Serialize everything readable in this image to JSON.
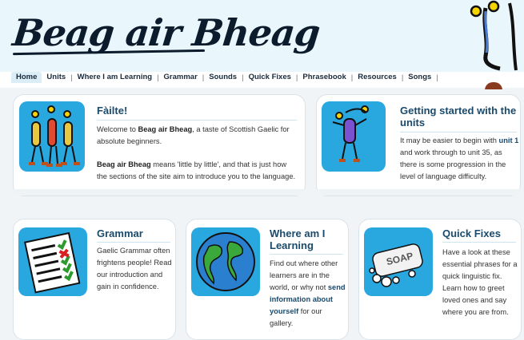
{
  "site": {
    "logo_text": "Beag air Bheag"
  },
  "nav": {
    "items": [
      "Home",
      "Units",
      "Where I am Learning",
      "Grammar",
      "Sounds",
      "Quick Fixes",
      "Phrasebook",
      "Resources",
      "Songs"
    ],
    "active": "Home",
    "separator": "|"
  },
  "cards": {
    "failte": {
      "title": "Fàilte!",
      "p1_pre": "Welcome to ",
      "p1_bold": "Beag air Bheag",
      "p1_post": ", a taste of Scottish Gaelic for absolute beginners.",
      "p2_bold": "Beag air Bheag",
      "p2_post": " means 'little by little', and that is just how the sections of the site aim to introduce you to the language.",
      "icon": "dancing-figures-icon"
    },
    "units": {
      "title": "Getting started with the units",
      "text_pre": "It may be easier to begin with ",
      "link": "unit 1",
      "text_post": " and work through to unit 35, as there is some progression in the level of language difficulty.",
      "icon": "juggler-icon"
    },
    "grammar": {
      "title": "Grammar",
      "text": "Gaelic Grammar often frightens people! Read our introduction and gain in confidence.",
      "icon": "checklist-icon"
    },
    "where": {
      "title": "Where am I Learning",
      "text_pre": "Find out where other learners are in the world, or why not ",
      "link": "send information about yourself",
      "text_post": " for our gallery.",
      "icon": "globe-icon"
    },
    "quickfixes": {
      "title": "Quick Fixes",
      "text": "Have a look at these essential phrases for a quick linguistic fix. Learn how to greet loved ones and say where you are from.",
      "icon": "soap-icon",
      "icon_text": "SOAP"
    }
  },
  "colors": {
    "accent": "#1a4a6c",
    "icon_bg": "#29a8e0",
    "header_bg": "#e9f6fb"
  }
}
